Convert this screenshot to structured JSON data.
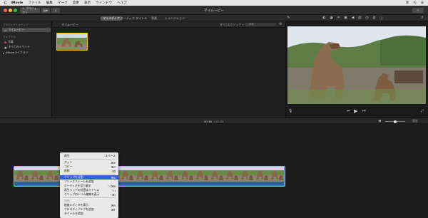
{
  "menubar": {
    "apple": "",
    "items": [
      "iMovie",
      "ファイル",
      "編集",
      "マーク",
      "変更",
      "表示",
      "ウインドウ",
      "ヘルプ"
    ],
    "status_icons": [
      "⌘",
      "Ⓐ",
      "☰"
    ]
  },
  "toolbar": {
    "traffic_colors": [
      "#ff5f57",
      "#febc2e",
      "#28c840"
    ],
    "back_label": "< プロジェクト",
    "window_title": "マイムービー"
  },
  "tabs": {
    "media": "マイメディア",
    "audio": "オーディオ",
    "titles": "タイトル",
    "backgrounds": "背景",
    "transitions": "トランジション"
  },
  "sidebar": {
    "section_project": "プロジェクトメディア",
    "project_item": "マイムービー",
    "section_library": "ライブラリ",
    "library_items": [
      "写真",
      "すべてのイベント"
    ],
    "movie_library": "iMovieライブラリ"
  },
  "browser": {
    "title": "マイムービー",
    "filter": "すべてのクリップ ÷",
    "search_placeholder": "検索"
  },
  "timeline": {
    "timecode": "00:16",
    "duration": "/ 01:03",
    "zoom_hint": "",
    "accent": "#e5b91c",
    "audio_color": "#2d5f9c"
  },
  "context_menu": {
    "items": [
      {
        "label": "再生",
        "shortcut": "スペース",
        "state": "normal"
      },
      {
        "sep": true
      },
      {
        "label": "カット",
        "shortcut": "⌘X",
        "state": "normal"
      },
      {
        "label": "コピー",
        "shortcut": "⌘C",
        "state": "normal"
      },
      {
        "label": "削除",
        "shortcut": "⌫",
        "state": "normal"
      },
      {
        "sep": true
      },
      {
        "label": "クリップを分割",
        "shortcut": "⌘B",
        "state": "highlight"
      },
      {
        "label": "フリーズフレームを追加",
        "shortcut": "",
        "state": "normal"
      },
      {
        "label": "オーディオを切り離す",
        "shortcut": "⌥⌘B",
        "state": "normal"
      },
      {
        "label": "再生ヘッドの位置までトリム",
        "shortcut": "⌥/",
        "state": "normal"
      },
      {
        "label": "クリップのトリム編集を表示",
        "shortcut": "⌃⌘/",
        "state": "normal"
      },
      {
        "sep": true
      },
      {
        "label": "追加",
        "shortcut": "",
        "state": "disabled"
      },
      {
        "label": "速度エディタを表示",
        "shortcut": "⌘R",
        "state": "normal"
      },
      {
        "label": "クロスディゾルブを追加",
        "shortcut": "⌘T",
        "state": "normal"
      },
      {
        "label": "タイトルを追加",
        "shortcut": "",
        "state": "normal"
      }
    ]
  }
}
